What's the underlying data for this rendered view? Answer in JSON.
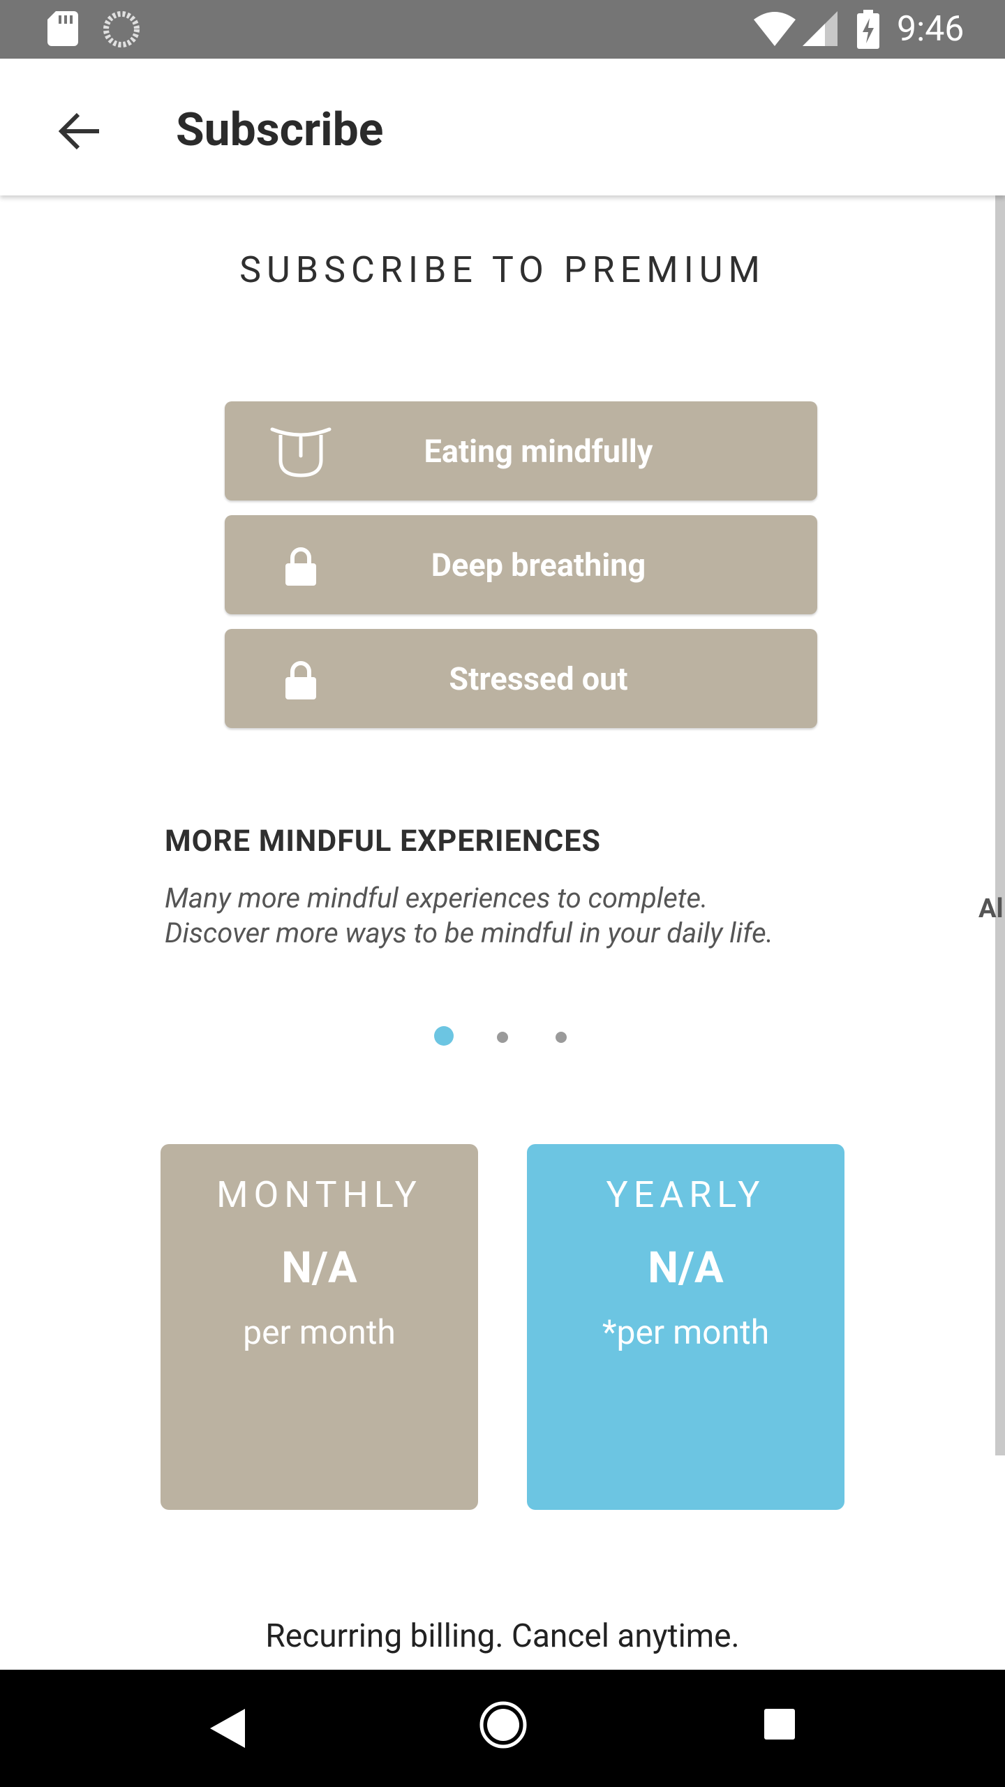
{
  "status_bar": {
    "time": "9:46",
    "icons": [
      "sd-card-icon",
      "sync-icon",
      "wifi-icon",
      "signal-icon",
      "battery-charging-icon"
    ]
  },
  "app_bar": {
    "title": "Subscribe",
    "back_icon": "arrow-back-icon"
  },
  "carousel": {
    "heading": "SUBSCRIBE TO PREMIUM",
    "experiences": [
      {
        "label": "Eating mindfully",
        "icon": "tongue-face-icon",
        "locked": false
      },
      {
        "label": "Deep breathing",
        "icon": "lock-icon",
        "locked": true
      },
      {
        "label": "Stressed out",
        "icon": "lock-icon",
        "locked": true
      }
    ],
    "section_title": "MORE MINDFUL EXPERIENCES",
    "section_desc_line1": "Many more mindful experiences to complete.",
    "section_desc_line2": "Discover more ways to be mindful in your daily life.",
    "next_page_peek": "Al",
    "page_count": 3,
    "active_page": 1
  },
  "plans": {
    "monthly": {
      "name": "MONTHLY",
      "price": "N/A",
      "period": "per month",
      "color": "#bbb2a1"
    },
    "yearly": {
      "name": "YEARLY",
      "price": "N/A",
      "period": "*per month",
      "color": "#6cc5e2"
    }
  },
  "billing_note": "Recurring billing. Cancel anytime.",
  "nav_bar": {
    "icons": [
      "nav-back-icon",
      "nav-home-icon",
      "nav-recents-icon"
    ]
  },
  "colors": {
    "accent": "#6cc5e2",
    "tan": "#bbb2a1",
    "status_bar": "#757575"
  }
}
